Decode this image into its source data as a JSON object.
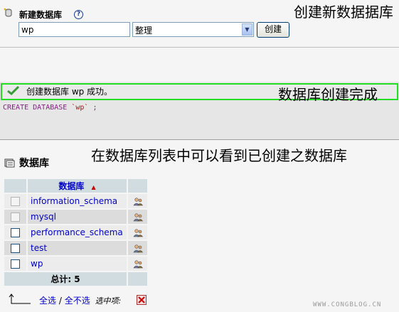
{
  "create": {
    "title": "新建数据库",
    "help": "?",
    "db_name_value": "wp",
    "collation": "整理",
    "create_button": "创建"
  },
  "annotations": {
    "create_new": "创建新数据据库",
    "created_done": "数据库创建完成",
    "visible_in_list": "在数据库列表中可以看到已创建之数据库"
  },
  "result": {
    "message": "创建数据库 wp 成功。",
    "sql_keyword": "CREATE DATABASE",
    "sql_name": "`wp`",
    "sql_end": ";"
  },
  "databases": {
    "title": "数据库",
    "column_header": "数据库",
    "sort_indicator": "▲",
    "rows": [
      {
        "name": "information_schema",
        "disabled": true
      },
      {
        "name": "mysql",
        "disabled": true
      },
      {
        "name": "performance_schema",
        "disabled": false
      },
      {
        "name": "test",
        "disabled": false
      },
      {
        "name": "wp",
        "disabled": false
      }
    ],
    "total_label": "总计: 5"
  },
  "footer": {
    "select_all": "全选",
    "separator": "/",
    "select_none": "全不选",
    "with_selected": "选中项:",
    "watermark": "WWW.CONGBLOG.CN"
  },
  "colors": {
    "link": "#0000cc",
    "success_border": "#22dd22",
    "sql_keyword": "#8a1b8a"
  }
}
